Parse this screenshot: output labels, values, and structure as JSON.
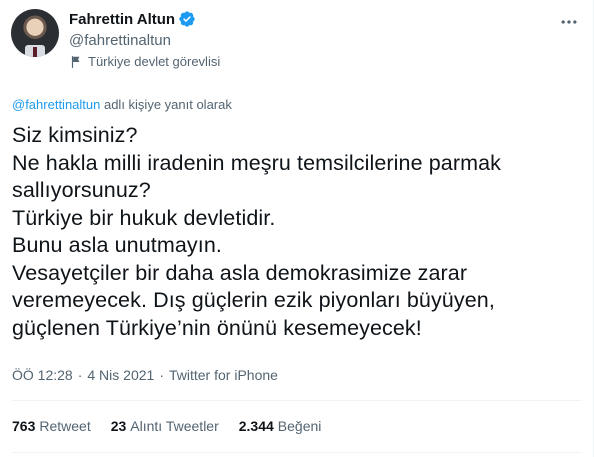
{
  "author": {
    "display_name": "Fahrettin Altun",
    "handle": "@fahrettinaltun",
    "label": "Türkiye devlet görevlisi"
  },
  "reply": {
    "mention": "@fahrettinaltun",
    "suffix": " adlı kişiye yanıt olarak"
  },
  "tweet": {
    "text": "Siz kimsiniz?\nNe hakla milli iradenin meşru temsilcilerine parmak\nsallıyorsunuz?\nTürkiye bir hukuk devletidir.\nBunu asla unutmayın.\nVesayetçiler bir daha asla demokrasimize zarar\nveremeyecek. Dış güçlerin ezik piyonları büyüyen,\ngüçlenen Türkiye’nin önünü kesemeyecek!"
  },
  "meta": {
    "time": "ÖÖ 12:28",
    "separator1": "·",
    "date": "4 Nis 2021",
    "separator2": "·",
    "source": "Twitter for iPhone"
  },
  "stats": {
    "retweets_count": "763",
    "retweets_label": "Retweet",
    "quotes_count": "23",
    "quotes_label": "Alıntı Tweetler",
    "likes_count": "2.344",
    "likes_label": "Beğeni"
  },
  "colors": {
    "accent": "#1d9bf0",
    "text_primary": "#0f1419",
    "text_secondary": "#536471",
    "divider": "#eff3f4"
  },
  "icons": [
    "verified-badge-icon",
    "flag-icon",
    "more-icon"
  ]
}
